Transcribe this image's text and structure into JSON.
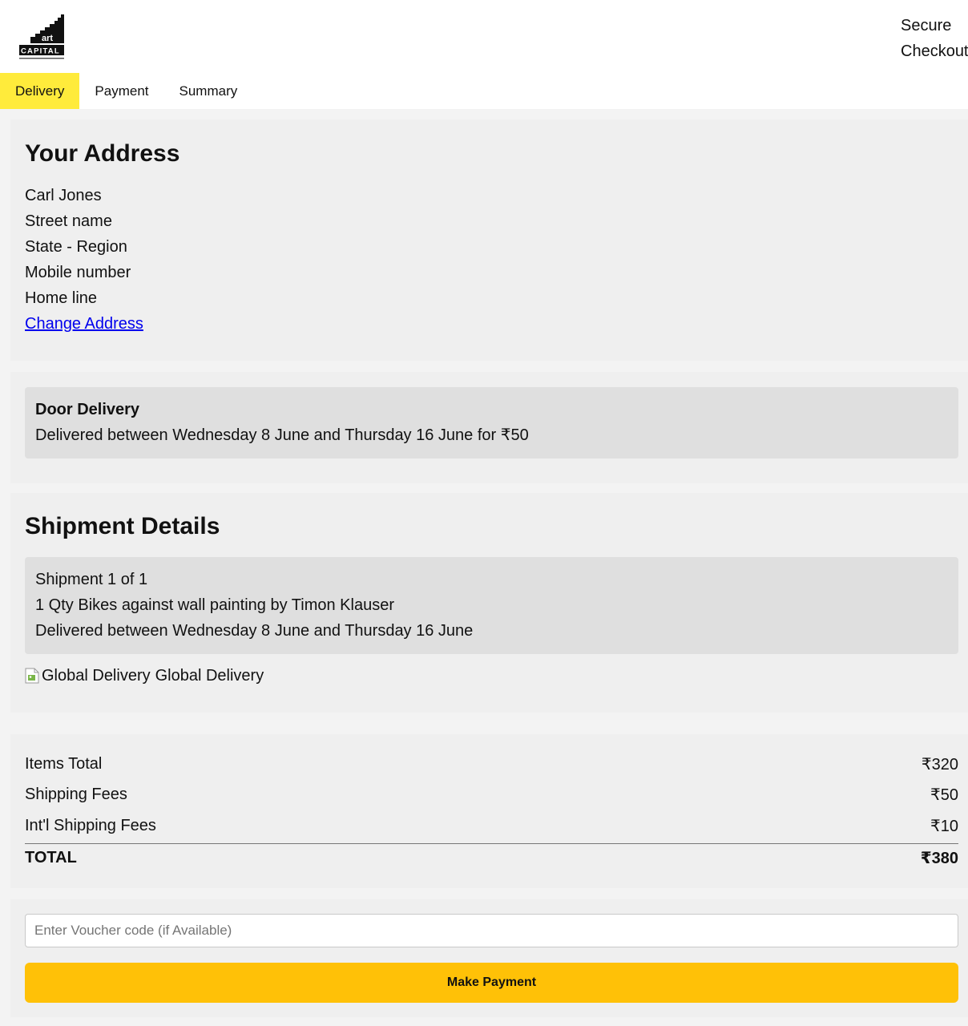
{
  "header": {
    "logo_text_top": "art",
    "logo_text_bottom": "CAPITAL",
    "secure_line1": "Secure",
    "secure_line2": "Checkout"
  },
  "tabs": [
    {
      "label": "Delivery",
      "active": true
    },
    {
      "label": "Payment",
      "active": false
    },
    {
      "label": "Summary",
      "active": false
    }
  ],
  "address": {
    "title": "Your Address",
    "lines": [
      "Carl Jones",
      "Street name",
      "State - Region",
      "Mobile number",
      "Home line"
    ],
    "change_link": "Change Address"
  },
  "delivery_option": {
    "title": "Door Delivery",
    "description": "Delivered between Wednesday 8 June and Thursday 16 June for ₹50"
  },
  "shipment": {
    "title": "Shipment Details",
    "lines": [
      "Shipment 1 of 1",
      "1 Qty Bikes against wall painting by Timon Klauser",
      "Delivered between Wednesday 8 June and Thursday 16 June"
    ],
    "image_alt": "Global Delivery",
    "image_caption": "Global Delivery"
  },
  "totals": {
    "rows": [
      {
        "label": "Items Total",
        "value": "₹320"
      },
      {
        "label": "Shipping Fees",
        "value": "₹50"
      },
      {
        "label": "Int'l Shipping Fees",
        "value": "₹10"
      }
    ],
    "total_label": "TOTAL",
    "total_value": "₹380"
  },
  "payment": {
    "voucher_placeholder": "Enter Voucher code (if Available)",
    "button_label": "Make Payment"
  },
  "colors": {
    "active_tab": "#ffeb3b",
    "pay_button": "#ffc107",
    "link": "#0000ee",
    "panel": "#efefef",
    "box": "#dfdfdf"
  }
}
